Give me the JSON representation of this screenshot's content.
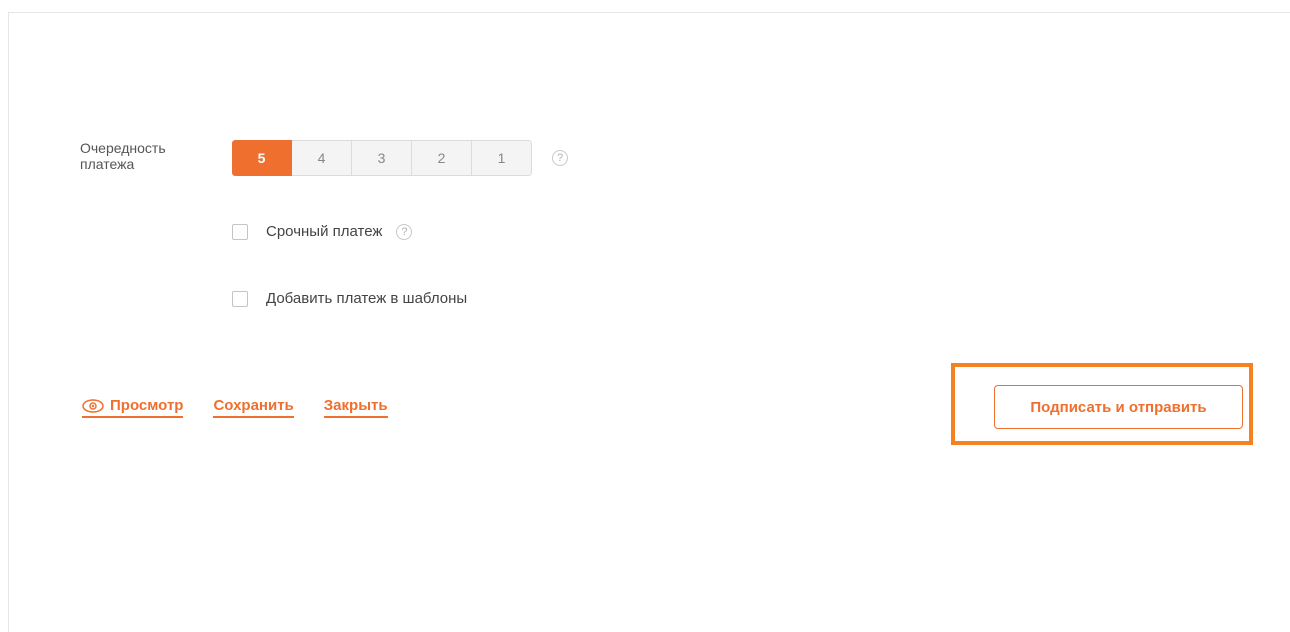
{
  "payment_priority": {
    "label": "Очередность платежа",
    "options": [
      "5",
      "4",
      "3",
      "2",
      "1"
    ],
    "selected": "5",
    "help_icon": "question-circle-icon"
  },
  "options": {
    "urgent": {
      "label": "Срочный платеж",
      "checked": false,
      "help_icon": "question-circle-icon"
    },
    "add_to_templates": {
      "label": "Добавить платеж в шаблоны",
      "checked": false
    }
  },
  "actions": {
    "preview_label": "Просмотр",
    "preview_icon": "eye-icon",
    "save_label": "Сохранить",
    "close_label": "Закрыть"
  },
  "submit": {
    "label": "Подписать и отправить"
  },
  "colors": {
    "accent": "#ef6f2e",
    "highlight": "#f58220"
  }
}
